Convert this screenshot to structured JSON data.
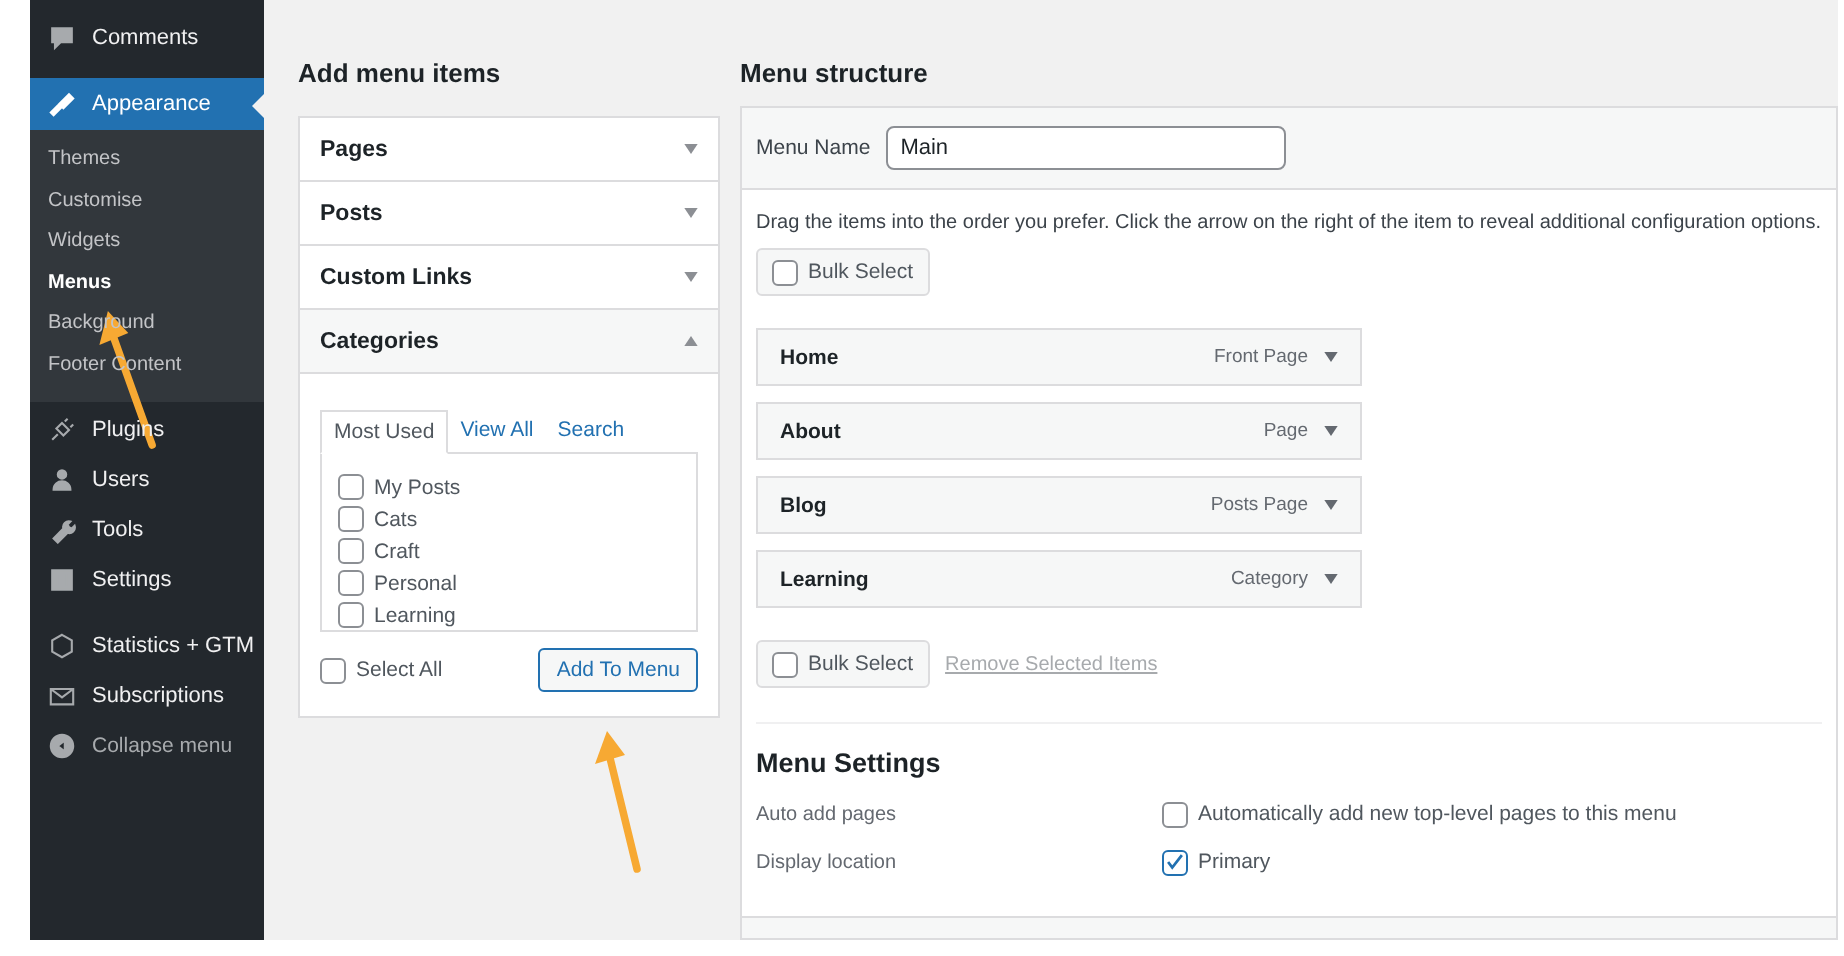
{
  "sidebar": {
    "items": [
      {
        "label": "Comments",
        "kind": "menu",
        "selected": false
      },
      {
        "label": "Appearance",
        "kind": "menu",
        "selected": true,
        "children": [
          {
            "label": "Themes",
            "selected": false
          },
          {
            "label": "Customise",
            "selected": false
          },
          {
            "label": "Widgets",
            "selected": false
          },
          {
            "label": "Menus",
            "selected": true
          },
          {
            "label": "Background",
            "selected": false
          },
          {
            "label": "Footer Content",
            "selected": false
          }
        ]
      },
      {
        "label": "Plugins",
        "kind": "menu",
        "selected": false
      },
      {
        "label": "Users",
        "kind": "menu",
        "selected": false
      },
      {
        "label": "Tools",
        "kind": "menu",
        "selected": false
      },
      {
        "label": "Settings",
        "kind": "menu",
        "selected": false
      },
      {
        "label": "Statistics + GTM",
        "kind": "menu",
        "selected": false
      },
      {
        "label": "Subscriptions",
        "kind": "menu",
        "selected": false
      },
      {
        "label": "Collapse menu",
        "kind": "collapse",
        "selected": false
      }
    ]
  },
  "add_menu_items": {
    "title": "Add menu items",
    "sections": [
      {
        "label": "Pages",
        "expanded": false
      },
      {
        "label": "Posts",
        "expanded": false
      },
      {
        "label": "Custom Links",
        "expanded": false
      },
      {
        "label": "Categories",
        "expanded": true
      }
    ],
    "tabs": [
      {
        "label": "Most Used",
        "selected": true
      },
      {
        "label": "View All",
        "selected": false
      },
      {
        "label": "Search",
        "selected": false
      }
    ],
    "checklist": [
      {
        "label": "My Posts",
        "checked": false
      },
      {
        "label": "Cats",
        "checked": false
      },
      {
        "label": "Craft",
        "checked": false
      },
      {
        "label": "Personal",
        "checked": false
      },
      {
        "label": "Learning",
        "checked": false
      }
    ],
    "select_all": {
      "label": "Select All",
      "checked": false
    },
    "add_button": "Add To Menu"
  },
  "menu_structure": {
    "title": "Menu structure",
    "menu_name": {
      "label": "Menu Name",
      "value": "Main"
    },
    "instructions": "Drag the items into the order you prefer. Click the arrow on the right of the item to reveal additional configuration options.",
    "bulk_select_top": {
      "label": "Bulk Select",
      "checked": false
    },
    "items": [
      {
        "title": "Home",
        "type": "Front Page"
      },
      {
        "title": "About",
        "type": "Page"
      },
      {
        "title": "Blog",
        "type": "Posts Page"
      },
      {
        "title": "Learning",
        "type": "Category"
      }
    ],
    "bulk_select_bottom": {
      "label": "Bulk Select",
      "checked": false
    },
    "remove_link": "Remove Selected Items",
    "settings": {
      "title": "Menu Settings",
      "rows": [
        {
          "label": "Auto add pages",
          "option": "Automatically add new top-level pages to this menu",
          "checked": false
        },
        {
          "label": "Display location",
          "option": "Primary",
          "checked": true
        }
      ]
    }
  }
}
